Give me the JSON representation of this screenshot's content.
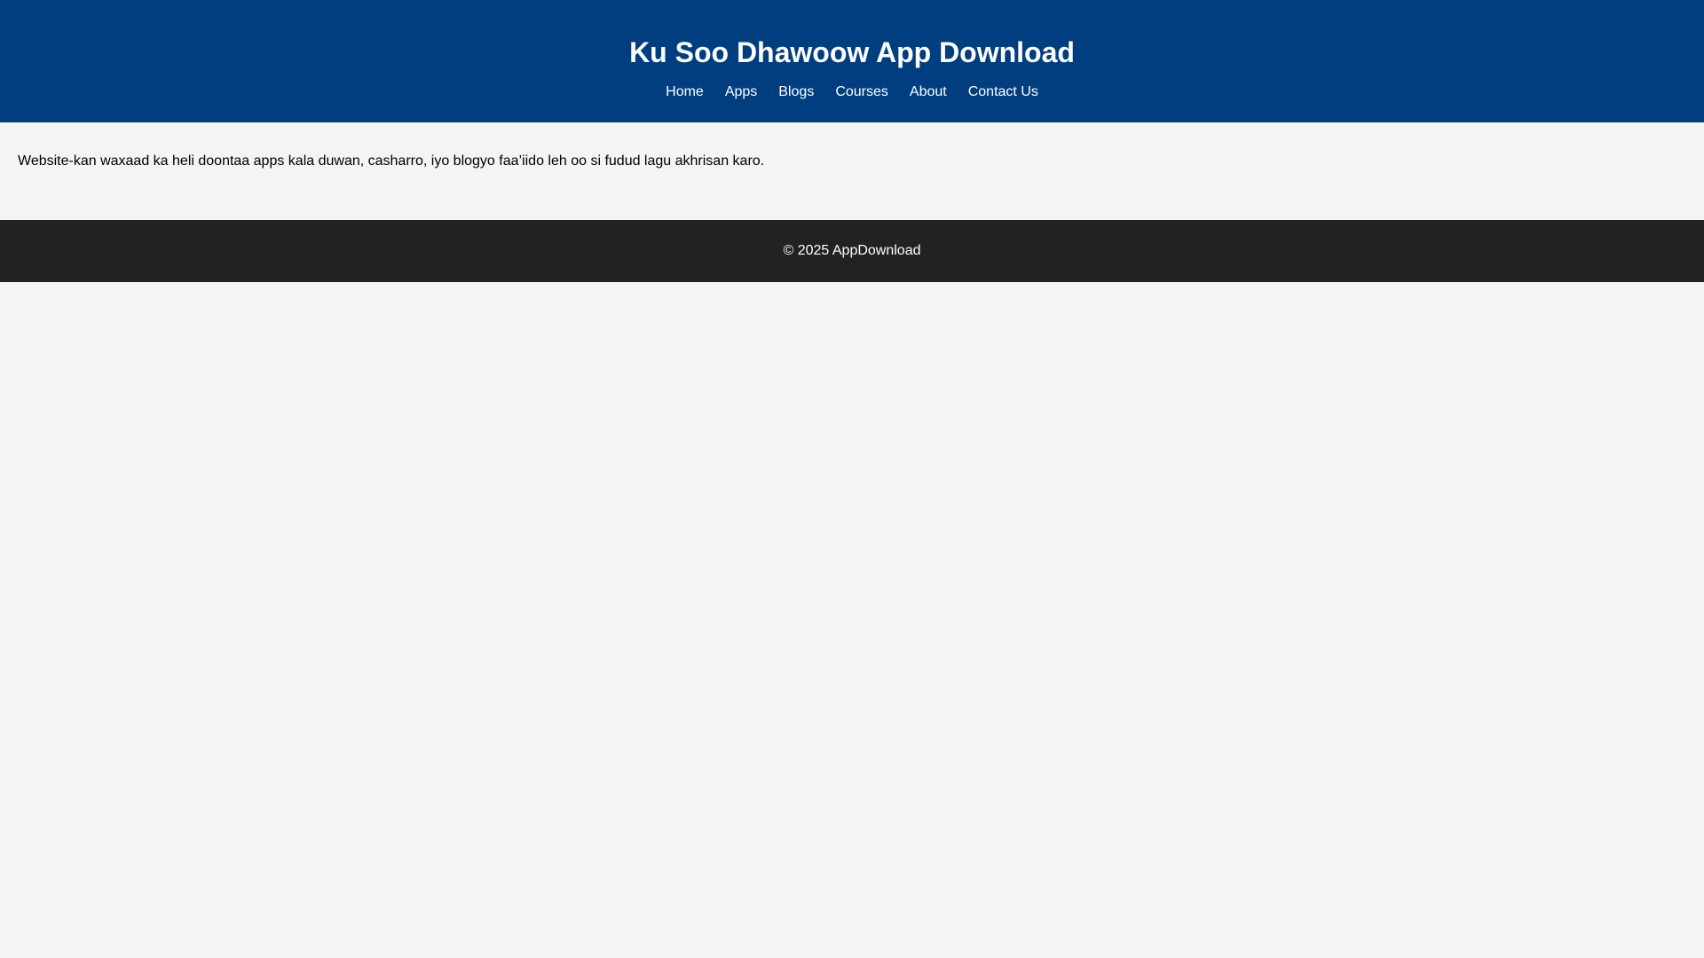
{
  "header": {
    "title": "Ku Soo Dhawoow App Download",
    "nav": [
      {
        "label": "Home"
      },
      {
        "label": "Apps"
      },
      {
        "label": "Blogs"
      },
      {
        "label": "Courses"
      },
      {
        "label": "About"
      },
      {
        "label": "Contact Us"
      }
    ]
  },
  "main": {
    "intro": "Website-kan waxaad ka heli doontaa apps kala duwan, casharro, iyo blogyo faa’iido leh oo si fudud lagu akhrisan karo."
  },
  "footer": {
    "copyright": "© 2025 AppDownload"
  },
  "colors": {
    "header_bg": "#003e80",
    "page_bg": "#f4f4f4",
    "footer_bg": "#222222",
    "header_text": "#ffffff"
  }
}
